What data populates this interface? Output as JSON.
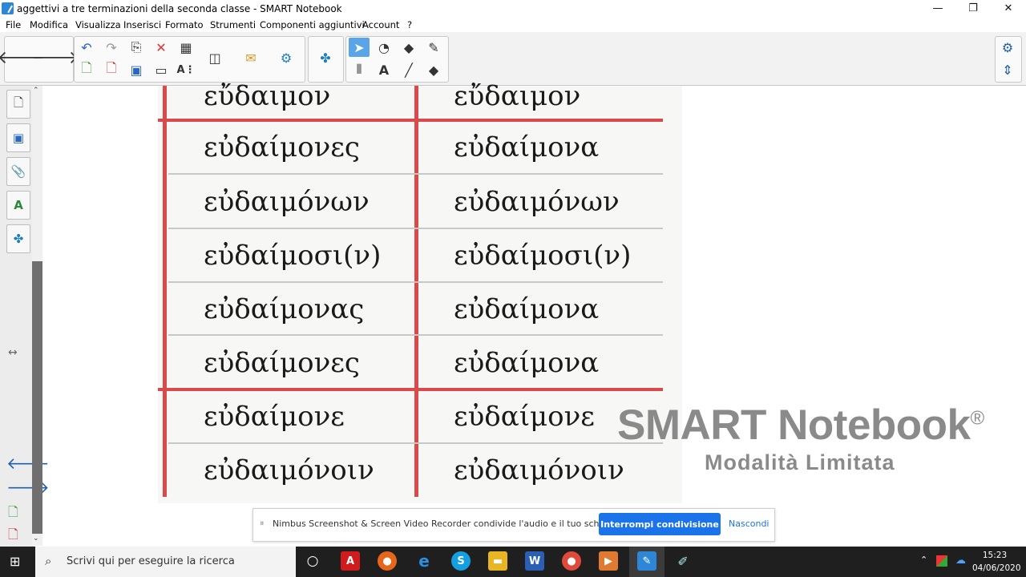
{
  "window": {
    "title": "aggettivi a tre terminazioni della seconda classe - SMART Notebook",
    "minimize": "—",
    "restore": "❐",
    "close": "✕"
  },
  "menu": [
    "File",
    "Modifica",
    "Visualizza",
    "Inserisci",
    "Formato",
    "Strumenti",
    "Componenti aggiuntivi",
    "Account",
    "?"
  ],
  "page": {
    "table_rows": [
      {
        "left": "εὔδαιμον",
        "right": "εὔδαιμον"
      },
      {
        "left": "εὐδαίμονες",
        "right": "εὐδαίμονα"
      },
      {
        "left": "εὐδαιμόνων",
        "right": "εὐδαιμόνων"
      },
      {
        "left": "εὐδαίμοσι(ν)",
        "right": "εὐδαίμοσι(ν)"
      },
      {
        "left": "εὐδαίμονας",
        "right": "εὐδαίμονα"
      },
      {
        "left": "εὐδαίμονες",
        "right": "εὐδαίμονα"
      },
      {
        "left": "εὐδαίμονε",
        "right": "εὐδαίμονε"
      },
      {
        "left": "εὐδαιμόνοιν",
        "right": "εὐδαιμόνοιν"
      }
    ]
  },
  "watermark": {
    "title": "SMART Notebook",
    "reg": "®",
    "subtitle": "Modalità Limitata"
  },
  "notification": {
    "message": "Nimbus Screenshot & Screen Video Recorder condivide l'audio e il tuo schermo.",
    "stop_label": "Interrompi condivisione",
    "hide_label": "Nascondi"
  },
  "taskbar": {
    "search_placeholder": "Scrivi qui per eseguire la ricerca",
    "time": "15:23",
    "date": "04/06/2020"
  },
  "colors": {
    "accent_blue": "#1a73e8",
    "table_red": "#d94a4a",
    "watermark_gray": "#8a8a8a"
  }
}
